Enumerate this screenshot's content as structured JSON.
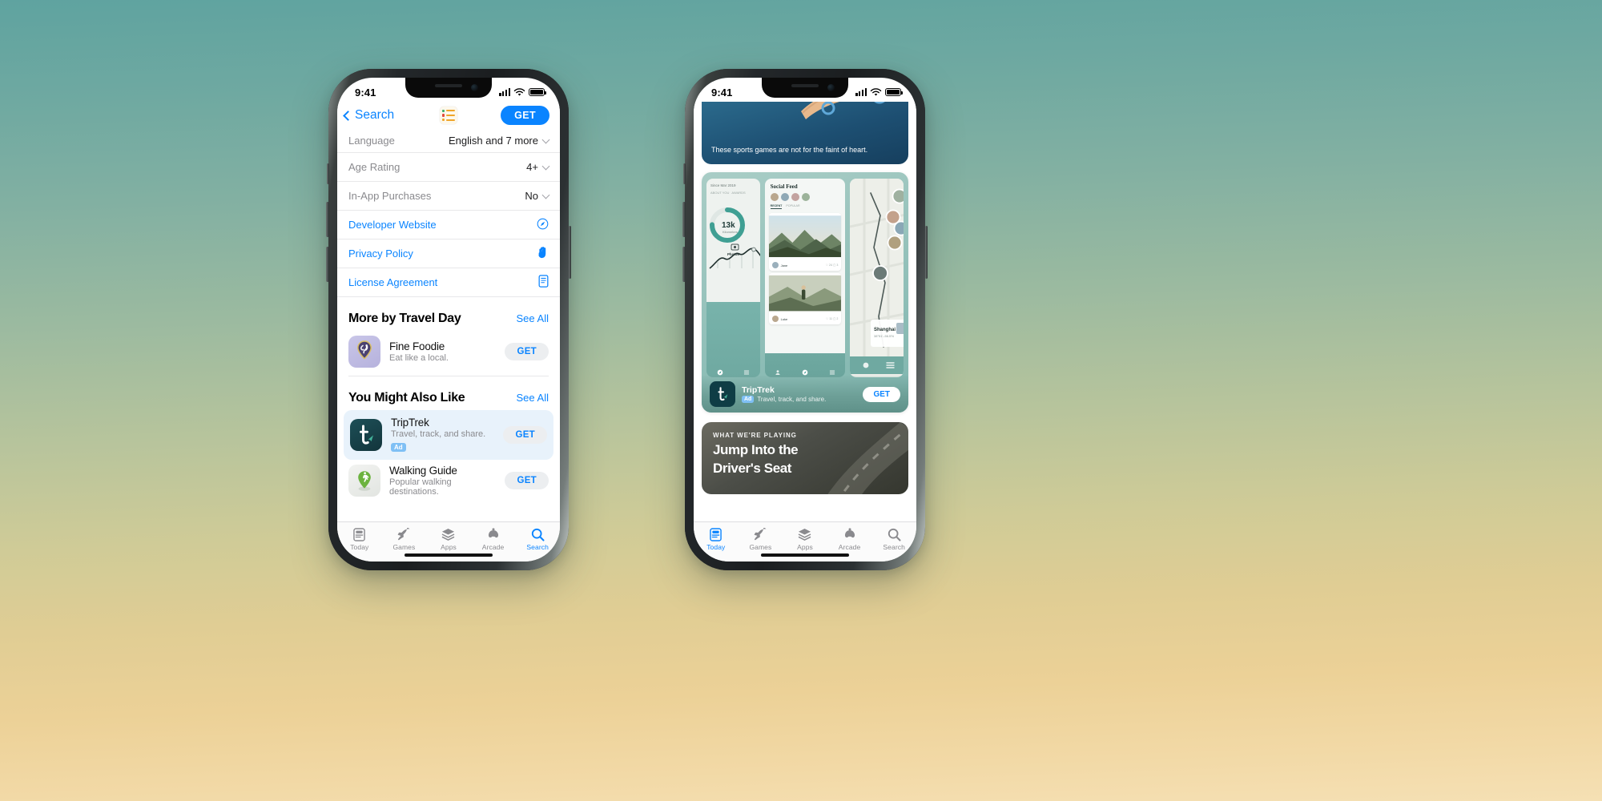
{
  "scene": {
    "background_top": "#5fa3a0",
    "background_bottom": "#f5e0b4",
    "accent_blue": "#0a84ff"
  },
  "left_phone": {
    "status_bar": {
      "time": "9:41"
    },
    "nav": {
      "back_label": "Search",
      "get_label": "GET",
      "app_icon_name": "travel-day-app-icon"
    },
    "info_rows": [
      {
        "label": "Language",
        "value": "English and 7 more"
      },
      {
        "label": "Age Rating",
        "value": "4+"
      },
      {
        "label": "In-App Purchases",
        "value": "No"
      }
    ],
    "link_rows": [
      {
        "label": "Developer Website",
        "icon": "compass-icon"
      },
      {
        "label": "Privacy Policy",
        "icon": "hand-raised-icon"
      },
      {
        "label": "License Agreement",
        "icon": "document-icon"
      }
    ],
    "sections": [
      {
        "title": "More by Travel Day",
        "see_all": "See All",
        "apps": [
          {
            "name": "Fine Foodie",
            "subtitle": "Eat like a local.",
            "get_label": "GET",
            "ad": null,
            "highlight": false,
            "icon": "fine-foodie-icon"
          }
        ]
      },
      {
        "title": "You Might Also Like",
        "see_all": "See All",
        "apps": [
          {
            "name": "TripTrek",
            "subtitle": "Travel, track, and share.",
            "get_label": "GET",
            "ad": "Ad",
            "highlight": true,
            "icon": "triptrek-icon"
          },
          {
            "name": "Walking Guide",
            "subtitle": "Popular walking destinations.",
            "get_label": "GET",
            "ad": null,
            "highlight": false,
            "icon": "walking-guide-icon"
          }
        ]
      }
    ],
    "tabbar": {
      "active": "Search",
      "tabs": [
        {
          "label": "Today",
          "icon": "today-icon"
        },
        {
          "label": "Games",
          "icon": "rocket-icon"
        },
        {
          "label": "Apps",
          "icon": "stack-icon"
        },
        {
          "label": "Arcade",
          "icon": "arcade-icon"
        },
        {
          "label": "Search",
          "icon": "search-icon"
        }
      ]
    }
  },
  "right_phone": {
    "status_bar": {
      "time": "9:41"
    },
    "top_card": {
      "caption": "These sports games are not for the faint of heart."
    },
    "gallery": {
      "shot_center_title": "Social Feed",
      "shot_center_names": [
        "Jane",
        "Luke"
      ],
      "shot_left_value": "13k",
      "shot_left_label": "Photos",
      "shot_right_label": "Shanghai",
      "shot_right_sub": "38°51′–56.5′N"
    },
    "ad_strip": {
      "name": "TripTrek",
      "subtitle": "Travel, track, and share.",
      "badge": "Ad",
      "get_label": "GET"
    },
    "playing_card": {
      "eyebrow": "WHAT WE'RE PLAYING",
      "headline_line1": "Jump Into the",
      "headline_line2": "Driver's Seat"
    },
    "tabbar": {
      "active": "Today",
      "tabs": [
        {
          "label": "Today",
          "icon": "today-icon"
        },
        {
          "label": "Games",
          "icon": "rocket-icon"
        },
        {
          "label": "Apps",
          "icon": "stack-icon"
        },
        {
          "label": "Arcade",
          "icon": "arcade-icon"
        },
        {
          "label": "Search",
          "icon": "search-icon"
        }
      ]
    }
  }
}
